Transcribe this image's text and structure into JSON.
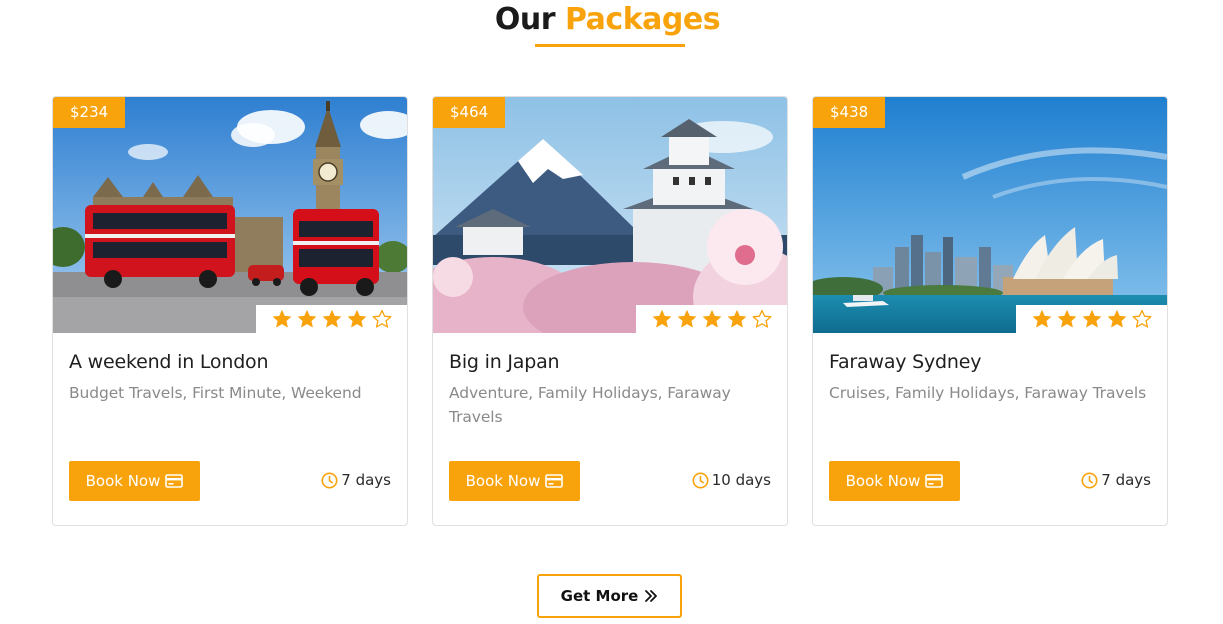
{
  "section": {
    "title_dark": "Our",
    "title_accent": "Packages"
  },
  "colors": {
    "accent": "#f9a30c",
    "text_dark": "#1f1f1f",
    "text_muted": "#8a8a8a"
  },
  "packages": [
    {
      "price": "$234",
      "rating": 4,
      "rating_max": 5,
      "title": "A weekend in London",
      "categories": "Budget Travels, First Minute, Weekend",
      "book_label": "Book Now",
      "duration": "7 days",
      "image_icon": "london-big-ben-buses-photo"
    },
    {
      "price": "$464",
      "rating": 4,
      "rating_max": 5,
      "title": "Big in Japan",
      "categories": "Adventure, Family Holidays, Faraway Travels",
      "book_label": "Book Now",
      "duration": "10 days",
      "image_icon": "japan-fuji-castle-blossom-photo"
    },
    {
      "price": "$438",
      "rating": 4,
      "rating_max": 5,
      "title": "Faraway Sydney",
      "categories": "Cruises, Family Holidays, Faraway Travels",
      "book_label": "Book Now",
      "duration": "7 days",
      "image_icon": "sydney-opera-house-photo"
    }
  ],
  "get_more_label": "Get More"
}
